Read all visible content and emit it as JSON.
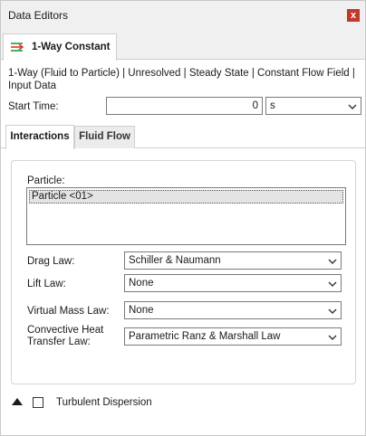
{
  "window": {
    "title": "Data Editors",
    "close_label": "x"
  },
  "doc_tab": {
    "label": "1-Way Constant"
  },
  "description": "1-Way (Fluid to Particle) | Unresolved | Steady State | Constant Flow Field | Input Data",
  "start_time": {
    "label": "Start Time:",
    "value": "0",
    "unit": "s"
  },
  "subtabs": [
    {
      "label": "Interactions"
    },
    {
      "label": "Fluid Flow"
    }
  ],
  "particle": {
    "label": "Particle:",
    "items": [
      "Particle <01>"
    ]
  },
  "fields": {
    "drag": {
      "label": "Drag Law:",
      "value": "Schiller & Naumann"
    },
    "lift": {
      "label": "Lift Law:",
      "value": "None"
    },
    "vmass": {
      "label": "Virtual Mass Law:",
      "value": "None"
    },
    "heat": {
      "label": "Convective Heat Transfer Law:",
      "value": "Parametric Ranz & Marshall Law"
    }
  },
  "turbulent": {
    "label": "Turbulent Dispersion",
    "checked": false
  }
}
